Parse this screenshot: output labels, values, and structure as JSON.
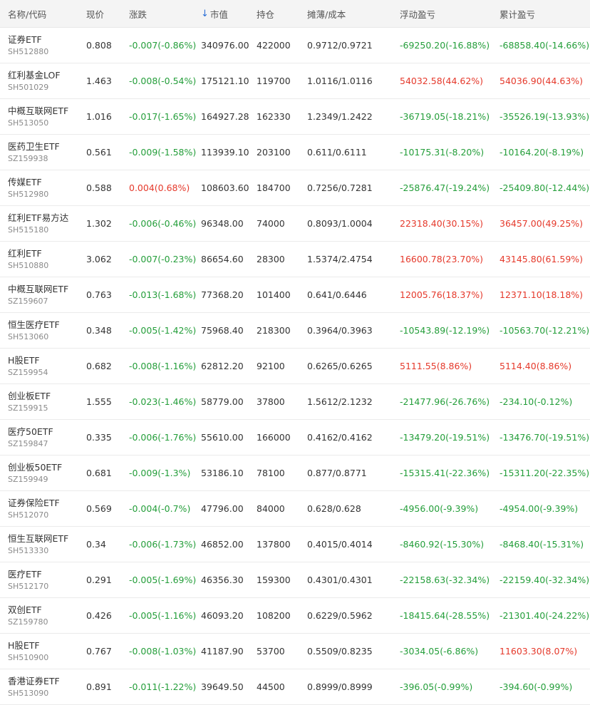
{
  "headers": {
    "name": "名称/代码",
    "price": "现价",
    "change": "涨跌",
    "market_value_arrow": "↓",
    "market_value": "市值",
    "holding": "持仓",
    "cost": "摊薄/成本",
    "float_pl": "浮动盈亏",
    "total_pl": "累计盈亏"
  },
  "colors": {
    "up": "#e5392b",
    "down": "#249e3a",
    "sort_arrow": "#2b6fd6",
    "header_bg": "#f4f4f4"
  },
  "rows": [
    {
      "name": "证券ETF",
      "code": "SH512880",
      "price": "0.808",
      "change": "-0.007(-0.86%)",
      "change_dir": "down",
      "market_value": "340976.00",
      "holding": "422000",
      "cost": "0.9712/0.9721",
      "float_pl": "-69250.20(-16.88%)",
      "float_dir": "down",
      "total_pl": "-68858.40(-14.66%)",
      "total_dir": "down"
    },
    {
      "name": "红利基金LOF",
      "code": "SH501029",
      "price": "1.463",
      "change": "-0.008(-0.54%)",
      "change_dir": "down",
      "market_value": "175121.10",
      "holding": "119700",
      "cost": "1.0116/1.0116",
      "float_pl": "54032.58(44.62%)",
      "float_dir": "up",
      "total_pl": "54036.90(44.63%)",
      "total_dir": "up"
    },
    {
      "name": "中概互联网ETF",
      "code": "SH513050",
      "price": "1.016",
      "change": "-0.017(-1.65%)",
      "change_dir": "down",
      "market_value": "164927.28",
      "holding": "162330",
      "cost": "1.2349/1.2422",
      "float_pl": "-36719.05(-18.21%)",
      "float_dir": "down",
      "total_pl": "-35526.19(-13.93%)",
      "total_dir": "down"
    },
    {
      "name": "医药卫生ETF",
      "code": "SZ159938",
      "price": "0.561",
      "change": "-0.009(-1.58%)",
      "change_dir": "down",
      "market_value": "113939.10",
      "holding": "203100",
      "cost": "0.611/0.6111",
      "float_pl": "-10175.31(-8.20%)",
      "float_dir": "down",
      "total_pl": "-10164.20(-8.19%)",
      "total_dir": "down"
    },
    {
      "name": "传媒ETF",
      "code": "SH512980",
      "price": "0.588",
      "change": "0.004(0.68%)",
      "change_dir": "up",
      "market_value": "108603.60",
      "holding": "184700",
      "cost": "0.7256/0.7281",
      "float_pl": "-25876.47(-19.24%)",
      "float_dir": "down",
      "total_pl": "-25409.80(-12.44%)",
      "total_dir": "down"
    },
    {
      "name": "红利ETF易方达",
      "code": "SH515180",
      "price": "1.302",
      "change": "-0.006(-0.46%)",
      "change_dir": "down",
      "market_value": "96348.00",
      "holding": "74000",
      "cost": "0.8093/1.0004",
      "float_pl": "22318.40(30.15%)",
      "float_dir": "up",
      "total_pl": "36457.00(49.25%)",
      "total_dir": "up"
    },
    {
      "name": "红利ETF",
      "code": "SH510880",
      "price": "3.062",
      "change": "-0.007(-0.23%)",
      "change_dir": "down",
      "market_value": "86654.60",
      "holding": "28300",
      "cost": "1.5374/2.4754",
      "float_pl": "16600.78(23.70%)",
      "float_dir": "up",
      "total_pl": "43145.80(61.59%)",
      "total_dir": "up"
    },
    {
      "name": "中概互联网ETF",
      "code": "SZ159607",
      "price": "0.763",
      "change": "-0.013(-1.68%)",
      "change_dir": "down",
      "market_value": "77368.20",
      "holding": "101400",
      "cost": "0.641/0.6446",
      "float_pl": "12005.76(18.37%)",
      "float_dir": "up",
      "total_pl": "12371.10(18.18%)",
      "total_dir": "up"
    },
    {
      "name": "恒生医疗ETF",
      "code": "SH513060",
      "price": "0.348",
      "change": "-0.005(-1.42%)",
      "change_dir": "down",
      "market_value": "75968.40",
      "holding": "218300",
      "cost": "0.3964/0.3963",
      "float_pl": "-10543.89(-12.19%)",
      "float_dir": "down",
      "total_pl": "-10563.70(-12.21%)",
      "total_dir": "down"
    },
    {
      "name": "H股ETF",
      "code": "SZ159954",
      "price": "0.682",
      "change": "-0.008(-1.16%)",
      "change_dir": "down",
      "market_value": "62812.20",
      "holding": "92100",
      "cost": "0.6265/0.6265",
      "float_pl": "5111.55(8.86%)",
      "float_dir": "up",
      "total_pl": "5114.40(8.86%)",
      "total_dir": "up"
    },
    {
      "name": "创业板ETF",
      "code": "SZ159915",
      "price": "1.555",
      "change": "-0.023(-1.46%)",
      "change_dir": "down",
      "market_value": "58779.00",
      "holding": "37800",
      "cost": "1.5612/2.1232",
      "float_pl": "-21477.96(-26.76%)",
      "float_dir": "down",
      "total_pl": "-234.10(-0.12%)",
      "total_dir": "down"
    },
    {
      "name": "医疗50ETF",
      "code": "SZ159847",
      "price": "0.335",
      "change": "-0.006(-1.76%)",
      "change_dir": "down",
      "market_value": "55610.00",
      "holding": "166000",
      "cost": "0.4162/0.4162",
      "float_pl": "-13479.20(-19.51%)",
      "float_dir": "down",
      "total_pl": "-13476.70(-19.51%)",
      "total_dir": "down"
    },
    {
      "name": "创业板50ETF",
      "code": "SZ159949",
      "price": "0.681",
      "change": "-0.009(-1.3%)",
      "change_dir": "down",
      "market_value": "53186.10",
      "holding": "78100",
      "cost": "0.877/0.8771",
      "float_pl": "-15315.41(-22.36%)",
      "float_dir": "down",
      "total_pl": "-15311.20(-22.35%)",
      "total_dir": "down"
    },
    {
      "name": "证券保险ETF",
      "code": "SH512070",
      "price": "0.569",
      "change": "-0.004(-0.7%)",
      "change_dir": "down",
      "market_value": "47796.00",
      "holding": "84000",
      "cost": "0.628/0.628",
      "float_pl": "-4956.00(-9.39%)",
      "float_dir": "down",
      "total_pl": "-4954.00(-9.39%)",
      "total_dir": "down"
    },
    {
      "name": "恒生互联网ETF",
      "code": "SH513330",
      "price": "0.34",
      "change": "-0.006(-1.73%)",
      "change_dir": "down",
      "market_value": "46852.00",
      "holding": "137800",
      "cost": "0.4015/0.4014",
      "float_pl": "-8460.92(-15.30%)",
      "float_dir": "down",
      "total_pl": "-8468.40(-15.31%)",
      "total_dir": "down"
    },
    {
      "name": "医疗ETF",
      "code": "SH512170",
      "price": "0.291",
      "change": "-0.005(-1.69%)",
      "change_dir": "down",
      "market_value": "46356.30",
      "holding": "159300",
      "cost": "0.4301/0.4301",
      "float_pl": "-22158.63(-32.34%)",
      "float_dir": "down",
      "total_pl": "-22159.40(-32.34%)",
      "total_dir": "down"
    },
    {
      "name": "双创ETF",
      "code": "SZ159780",
      "price": "0.426",
      "change": "-0.005(-1.16%)",
      "change_dir": "down",
      "market_value": "46093.20",
      "holding": "108200",
      "cost": "0.6229/0.5962",
      "float_pl": "-18415.64(-28.55%)",
      "float_dir": "down",
      "total_pl": "-21301.40(-24.22%)",
      "total_dir": "down"
    },
    {
      "name": "H股ETF",
      "code": "SH510900",
      "price": "0.767",
      "change": "-0.008(-1.03%)",
      "change_dir": "down",
      "market_value": "41187.90",
      "holding": "53700",
      "cost": "0.5509/0.8235",
      "float_pl": "-3034.05(-6.86%)",
      "float_dir": "down",
      "total_pl": "11603.30(8.07%)",
      "total_dir": "up"
    },
    {
      "name": "香港证券ETF",
      "code": "SH513090",
      "price": "0.891",
      "change": "-0.011(-1.22%)",
      "change_dir": "down",
      "market_value": "39649.50",
      "holding": "44500",
      "cost": "0.8999/0.8999",
      "float_pl": "-396.05(-0.99%)",
      "float_dir": "down",
      "total_pl": "-394.60(-0.99%)",
      "total_dir": "down"
    }
  ]
}
